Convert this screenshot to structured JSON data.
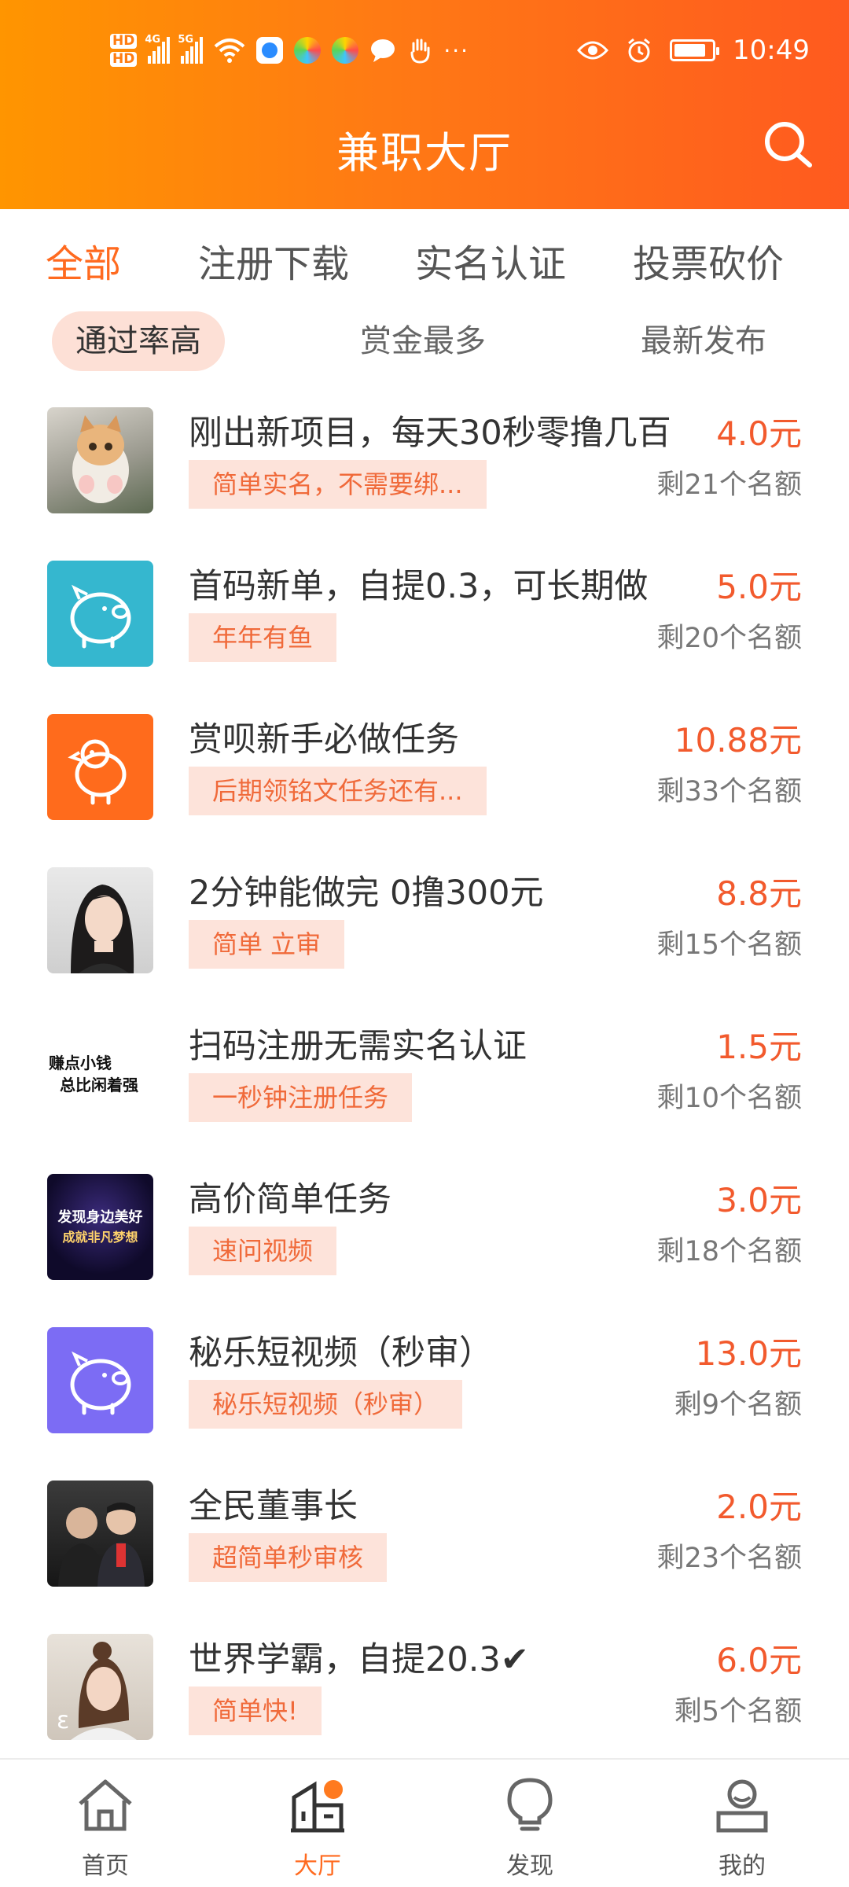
{
  "status_bar": {
    "hd1": "HD",
    "hd2": "HD",
    "net1": "4G",
    "net2": "5G",
    "time": "10:49",
    "battery_level": 0.85
  },
  "header": {
    "title": "兼职大厅"
  },
  "category_tabs": [
    {
      "label": "全部",
      "active": true
    },
    {
      "label": "注册下载",
      "active": false
    },
    {
      "label": "实名认证",
      "active": false
    },
    {
      "label": "投票砍价",
      "active": false
    }
  ],
  "sort_filters": [
    {
      "label": "通过率高",
      "active": true
    },
    {
      "label": "赏金最多",
      "active": false
    },
    {
      "label": "最新发布",
      "active": false
    }
  ],
  "tasks": [
    {
      "title": "刚出新项目，每天30秒零撸几百",
      "tag": "简单实名，不需要绑...",
      "price": "4.0元",
      "remaining": "剩21个名额",
      "icon": "kitten-photo"
    },
    {
      "title": "首码新单，自提0.3，可长期做",
      "tag": "年年有鱼",
      "price": "5.0元",
      "remaining": "剩20个名额",
      "icon": "pig-icon"
    },
    {
      "title": "赏呗新手必做任务",
      "tag": "后期领铭文任务还有...",
      "price": "10.88元",
      "remaining": "剩33个名额",
      "icon": "chick-icon"
    },
    {
      "title": "2分钟能做完  0撸300元",
      "tag": "简单  立审",
      "price": "8.8元",
      "remaining": "剩15个名额",
      "icon": "girl-portrait"
    },
    {
      "title": "扫码注册无需实名认证",
      "tag": "一秒钟注册任务",
      "price": "1.5元",
      "remaining": "剩10个名额",
      "icon": "text-logo",
      "thumb_text_1": "赚点小钱",
      "thumb_text_2": "总比闲着强"
    },
    {
      "title": "高价简单任务",
      "tag": "速问视频",
      "price": "3.0元",
      "remaining": "剩18个名额",
      "icon": "poster-thumb",
      "thumb_text_1": "发现身边美好",
      "thumb_text_2": "成就非凡梦想"
    },
    {
      "title": "秘乐短视频（秒审）",
      "tag": "秘乐短视频（秒审）",
      "price": "13.0元",
      "remaining": "剩9个名额",
      "icon": "pig-icon"
    },
    {
      "title": "全民董事长",
      "tag": "超简单秒审核",
      "price": "2.0元",
      "remaining": "剩23个名额",
      "icon": "people-photo"
    },
    {
      "title": "世界学霸，自提20.3✔",
      "tag": "简单快!",
      "price": "6.0元",
      "remaining": "剩5个名额",
      "icon": "girl-portrait"
    }
  ],
  "bottom_nav": [
    {
      "label": "首页",
      "active": false,
      "icon": "home-icon"
    },
    {
      "label": "大厅",
      "active": true,
      "icon": "hall-icon"
    },
    {
      "label": "发现",
      "active": false,
      "icon": "bulb-icon"
    },
    {
      "label": "我的",
      "active": false,
      "icon": "profile-icon"
    }
  ],
  "colors": {
    "accent": "#ff6a1f",
    "header_start": "#ff9500",
    "header_end": "#ff5a1f",
    "price": "#f25a2d",
    "tag_bg": "#fde3da",
    "tag_text": "#f06a3a"
  }
}
